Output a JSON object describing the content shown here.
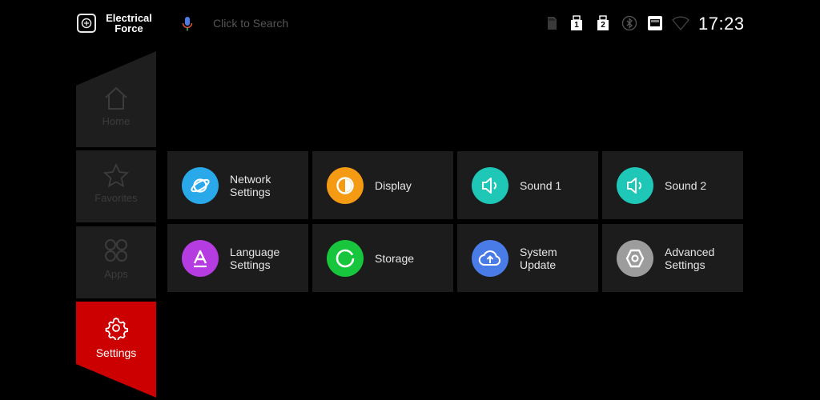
{
  "header": {
    "brand_line1": "Electrical",
    "brand_line2": "Force",
    "search_placeholder": "Click to Search",
    "usb1": "1",
    "usb2": "2",
    "time": "17:23"
  },
  "nav": {
    "home": "Home",
    "favorites": "Favorites",
    "apps": "Apps",
    "settings": "Settings"
  },
  "tiles": [
    {
      "line1": "Network",
      "line2": "Settings",
      "color": "#29a8ea"
    },
    {
      "line1": "Display",
      "line2": "",
      "color": "#f59a13"
    },
    {
      "line1": "Sound 1",
      "line2": "",
      "color": "#1ec7b6"
    },
    {
      "line1": "Sound 2",
      "line2": "",
      "color": "#1ec7b6"
    },
    {
      "line1": "Language",
      "line2": "Settings",
      "color": "#b43ce0"
    },
    {
      "line1": "Storage",
      "line2": "",
      "color": "#17c63c"
    },
    {
      "line1": "System",
      "line2": "Update",
      "color": "#4a7ce8"
    },
    {
      "line1": "Advanced",
      "line2": "Settings",
      "color": "#9c9c9c"
    }
  ],
  "colors": {
    "accent": "#cc0000",
    "nav_bg": "#1e1e1e",
    "tile_bg": "#1c1c1c"
  }
}
